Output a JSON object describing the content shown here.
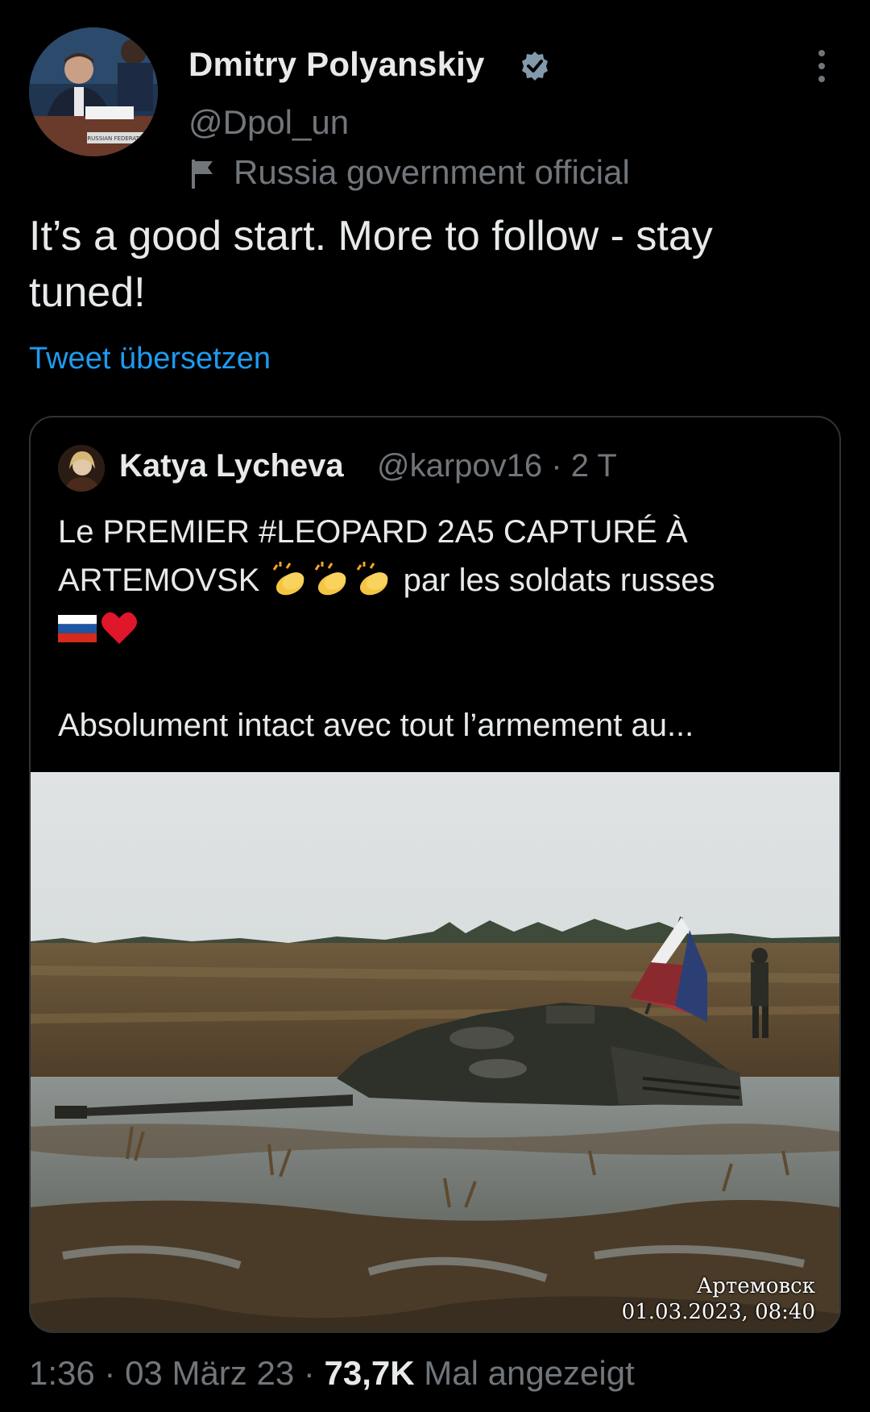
{
  "author": {
    "name": "Dmitry Polyanskiy",
    "handle": "@Dpol_un",
    "label": "Russia government official",
    "verified_color": "#829aab",
    "avatar_plaque": "RUSSIAN FEDERATION"
  },
  "tweet": {
    "text": "It’s a good start. More to follow - stay tuned!",
    "translate_label": "Tweet übersetzen"
  },
  "quoted": {
    "name": "Katya Lycheva",
    "handle_and_time": "@karpov16 · 2 T",
    "line1": "Le PREMIER #LEOPARD 2A5 CAPTURÉ À ARTEMOVSK",
    "line1_after": " par les soldats russes",
    "line2": "Absolument intact avec tout l’armement au...",
    "image_caption_place": "Артемовск",
    "image_caption_datetime": "01.03.2023, 08:40"
  },
  "footer": {
    "time": "1:36",
    "sep1": " · ",
    "date": "03 März 23",
    "sep2": " · ",
    "views": "73,7K",
    "views_label": " Mal angezeigt"
  },
  "icons": {
    "verified": "verified-badge-icon",
    "gov_flag": "flag-icon",
    "more": "more-vertical-icon",
    "clap": "clapping-hands-emoji",
    "russia_flag": "russia-flag-emoji",
    "heart": "red-heart-emoji"
  },
  "colors": {
    "background": "#000000",
    "text_primary": "#e7e9ea",
    "text_secondary": "#71767b",
    "link": "#1d9bf0",
    "border": "#2f3336"
  }
}
